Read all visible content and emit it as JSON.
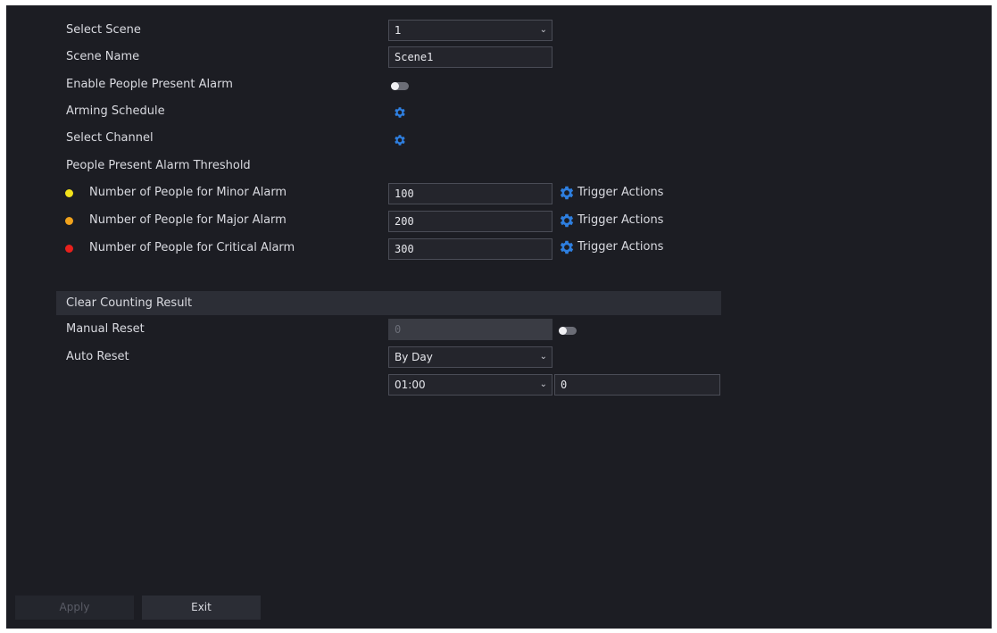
{
  "scene": {
    "select_label": "Select Scene",
    "select_value": "1",
    "name_label": "Scene Name",
    "name_value": "Scene1",
    "enable_label": "Enable People Present Alarm",
    "enable_on": false,
    "arming_label": "Arming Schedule",
    "channel_label": "Select Channel"
  },
  "threshold": {
    "title": "People Present Alarm Threshold",
    "rows": [
      {
        "label": "Number of People for Minor Alarm",
        "value": "100",
        "color": "#f2e21b",
        "action": "Trigger Actions"
      },
      {
        "label": "Number of People for Major Alarm",
        "value": "200",
        "color": "#f0a21c",
        "action": "Trigger Actions"
      },
      {
        "label": "Number of People for Critical Alarm",
        "value": "300",
        "color": "#e8201c",
        "action": "Trigger Actions"
      }
    ]
  },
  "clear": {
    "section_title": "Clear Counting Result",
    "manual_label": "Manual Reset",
    "manual_value": "0",
    "manual_on": false,
    "auto_label": "Auto Reset",
    "auto_value": "By Day",
    "time_value": "01:00",
    "extra_value": "0"
  },
  "buttons": {
    "apply": "Apply",
    "exit": "Exit"
  },
  "colors": {
    "accent": "#2e7fe0",
    "background": "#1c1d23"
  },
  "icons": {
    "dropdown": "chevron-down-icon",
    "settings": "gear-icon"
  }
}
